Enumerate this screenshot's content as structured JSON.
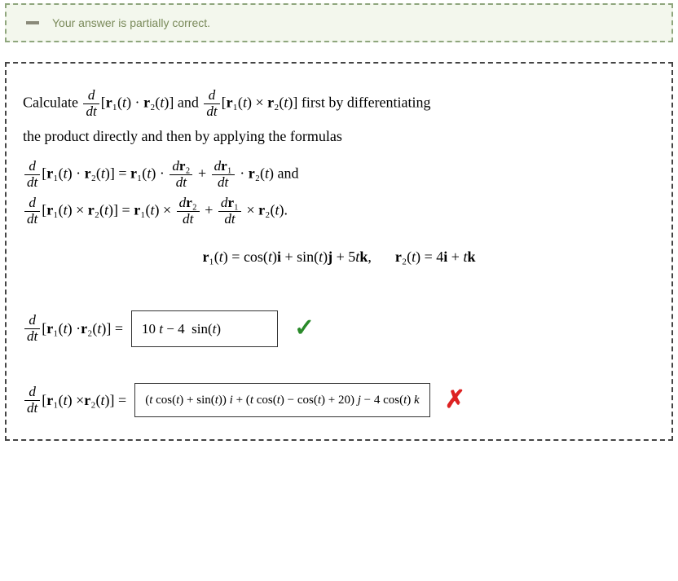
{
  "feedback": {
    "label": "Your answer is partially correct."
  },
  "problem": {
    "intro_prefix": "Calculate ",
    "intro_mid": " and ",
    "intro_suffix": " first by differentiating",
    "intro_line2": "the product directly and then by applying the formulas",
    "dot_formula_end": " and",
    "cross_formula_end": ".",
    "r1_def": "cos(t)i + sin(t)j + 5tk,",
    "r2_def": "4i + tk"
  },
  "answers": {
    "dot": {
      "value": "10 t − 4 sin(t)",
      "correct": true
    },
    "cross": {
      "value": "(t cos(t) + sin(t)) i + (t cos(t) − cos(t) + 20) j − 4 cos(t) k",
      "correct": false
    }
  },
  "math": {
    "ddt_num": "d",
    "ddt_den": "dt",
    "dr1_num": "dr₁",
    "dr2_num": "dr₂",
    "r1": "r₁(t)",
    "r2": "r₂(t)",
    "r1_eq": "r₁(t) = ",
    "r2_eq": "r₂(t) = "
  }
}
